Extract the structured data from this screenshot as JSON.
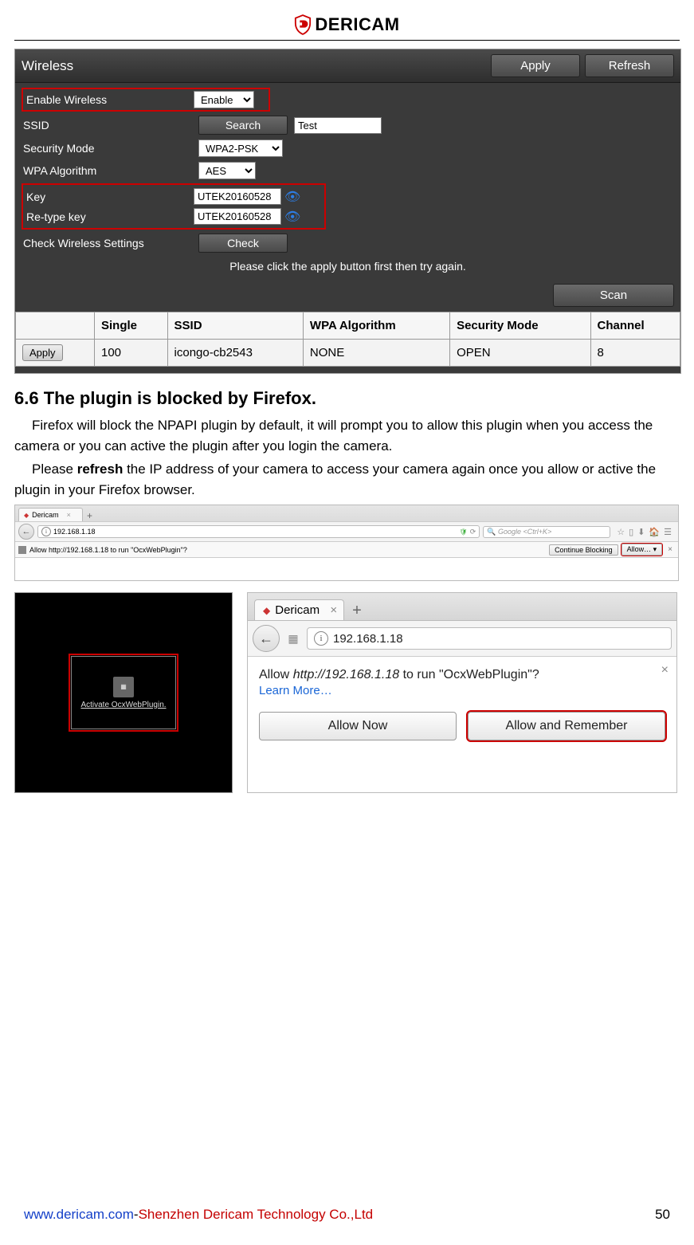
{
  "brand": {
    "name": "DERICAM"
  },
  "wireless": {
    "panel_title": "Wireless",
    "apply": "Apply",
    "refresh": "Refresh",
    "rows": {
      "enable_label": "Enable Wireless",
      "enable_value": "Enable",
      "ssid_label": "SSID",
      "search_btn": "Search",
      "ssid_value": "Test",
      "secmode_label": "Security Mode",
      "secmode_value": "WPA2-PSK",
      "algo_label": "WPA Algorithm",
      "algo_value": "AES",
      "key_label": "Key",
      "key_value": "UTEK20160528",
      "rekey_label": "Re-type key",
      "rekey_value": "UTEK20160528",
      "check_label": "Check Wireless Settings",
      "check_btn": "Check"
    },
    "hint": "Please click the apply button first then try again.",
    "scan": "Scan",
    "table_headers": {
      "single": "Single",
      "ssid": "SSID",
      "wpa": "WPA Algorithm",
      "sec": "Security Mode",
      "chan": "Channel"
    },
    "table_row": {
      "apply": "Apply",
      "single": "100",
      "ssid": "icongo-cb2543",
      "wpa": "NONE",
      "sec": "OPEN",
      "chan": "8"
    }
  },
  "section": {
    "heading": "6.6 The plugin is blocked by Firefox.",
    "p1a": "Firefox will block the NPAPI plugin by default, it will prompt you to allow this plugin when you access the camera or you can active the plugin after you login the camera.",
    "p2a": "Please ",
    "p2b": "refresh",
    "p2c": " the IP address of your camera to access your camera again once you allow or active the plugin in your Firefox browser."
  },
  "firefox_small": {
    "tab_title": "Dericam",
    "url": "192.168.1.18",
    "search_placeholder": "Google <Ctrl+K>",
    "info_text": "Allow http://192.168.1.18 to run \"OcxWebPlugin\"?",
    "continue_blocking": "Continue Blocking",
    "allow": "Allow…"
  },
  "plugin_box": {
    "caption": "Activate OcxWebPlugin."
  },
  "firefox_big": {
    "tab_title": "Dericam",
    "url": "192.168.1.18",
    "prompt_prefix": "Allow ",
    "prompt_url": "http://192.168.1.18",
    "prompt_suffix": " to run \"OcxWebPlugin\"?",
    "learn_more": "Learn More…",
    "allow_now": "Allow Now",
    "allow_remember": "Allow and Remember"
  },
  "footer": {
    "url": "www.dericam.com",
    "sep": "-",
    "company": "Shenzhen Dericam Technology Co.,Ltd",
    "page": "50"
  }
}
